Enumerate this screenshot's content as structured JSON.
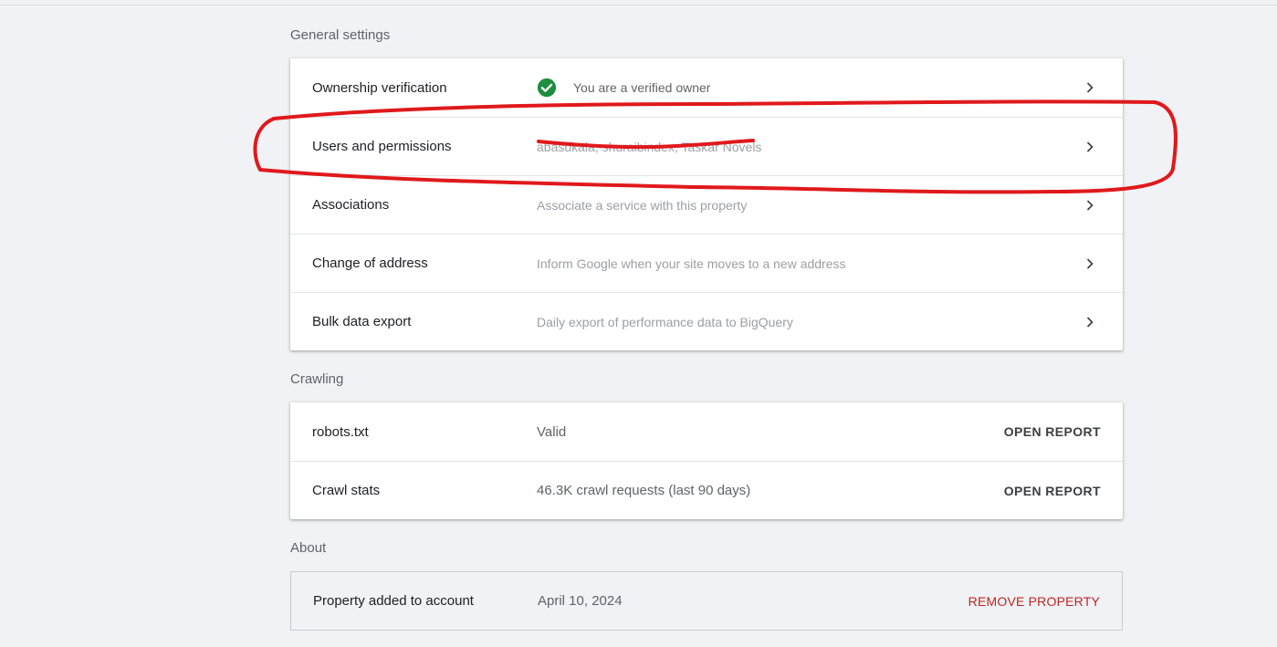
{
  "sections": {
    "general": {
      "title": "General settings",
      "rows": [
        {
          "label": "Ownership verification",
          "value": "You are a verified owner"
        },
        {
          "label": "Users and permissions",
          "value": "abasukala, shuraibindex, Taskar Novels"
        },
        {
          "label": "Associations",
          "value": "Associate a service with this property"
        },
        {
          "label": "Change of address",
          "value": "Inform Google when your site moves to a new address"
        },
        {
          "label": "Bulk data export",
          "value": "Daily export of performance data to BigQuery"
        }
      ]
    },
    "crawling": {
      "title": "Crawling",
      "rows": [
        {
          "label": "robots.txt",
          "value": "Valid",
          "action": "OPEN REPORT"
        },
        {
          "label": "Crawl stats",
          "value": "46.3K crawl requests (last 90 days)",
          "action": "OPEN REPORT"
        }
      ]
    },
    "about": {
      "title": "About",
      "rows": [
        {
          "label": "Property added to account",
          "value": "April 10, 2024",
          "action": "REMOVE PROPERTY"
        }
      ]
    }
  },
  "colors": {
    "background": "#f0f2f5",
    "verified_green": "#1e8e3e",
    "danger_red": "#c5221f",
    "annotation_red": "#e0191c"
  },
  "icons": {
    "verified": "check-circle-icon",
    "row_nav": "chevron-right-icon"
  }
}
